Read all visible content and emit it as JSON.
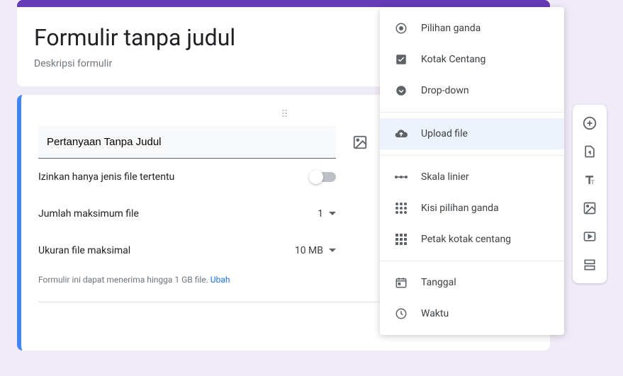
{
  "header": {
    "title": "Formulir tanpa judul",
    "description": "Deskripsi formulir"
  },
  "question": {
    "title": "Pertanyaan Tanpa Judul",
    "allow_specific_types_label": "Izinkan hanya jenis file tertentu",
    "max_files_label": "Jumlah maksimum file",
    "max_files_value": "1",
    "max_size_label": "Ukuran file maksimal",
    "max_size_value": "10 MB",
    "caption_prefix": "Formulir ini dapat menerima hingga 1 GB file.  ",
    "caption_link": "Ubah"
  },
  "dropdown": {
    "items": [
      {
        "label": "Pilihan ganda",
        "icon": "radio"
      },
      {
        "label": "Kotak Centang",
        "icon": "checkbox"
      },
      {
        "label": "Drop-down",
        "icon": "dropdown"
      }
    ],
    "items2": [
      {
        "label": "Upload file",
        "icon": "upload",
        "selected": true
      }
    ],
    "items3": [
      {
        "label": "Skala linier",
        "icon": "scale"
      },
      {
        "label": "Kisi pilihan ganda",
        "icon": "grid-radio"
      },
      {
        "label": "Petak kotak centang",
        "icon": "grid-check"
      }
    ],
    "items4": [
      {
        "label": "Tanggal",
        "icon": "date"
      },
      {
        "label": "Waktu",
        "icon": "time"
      }
    ]
  }
}
